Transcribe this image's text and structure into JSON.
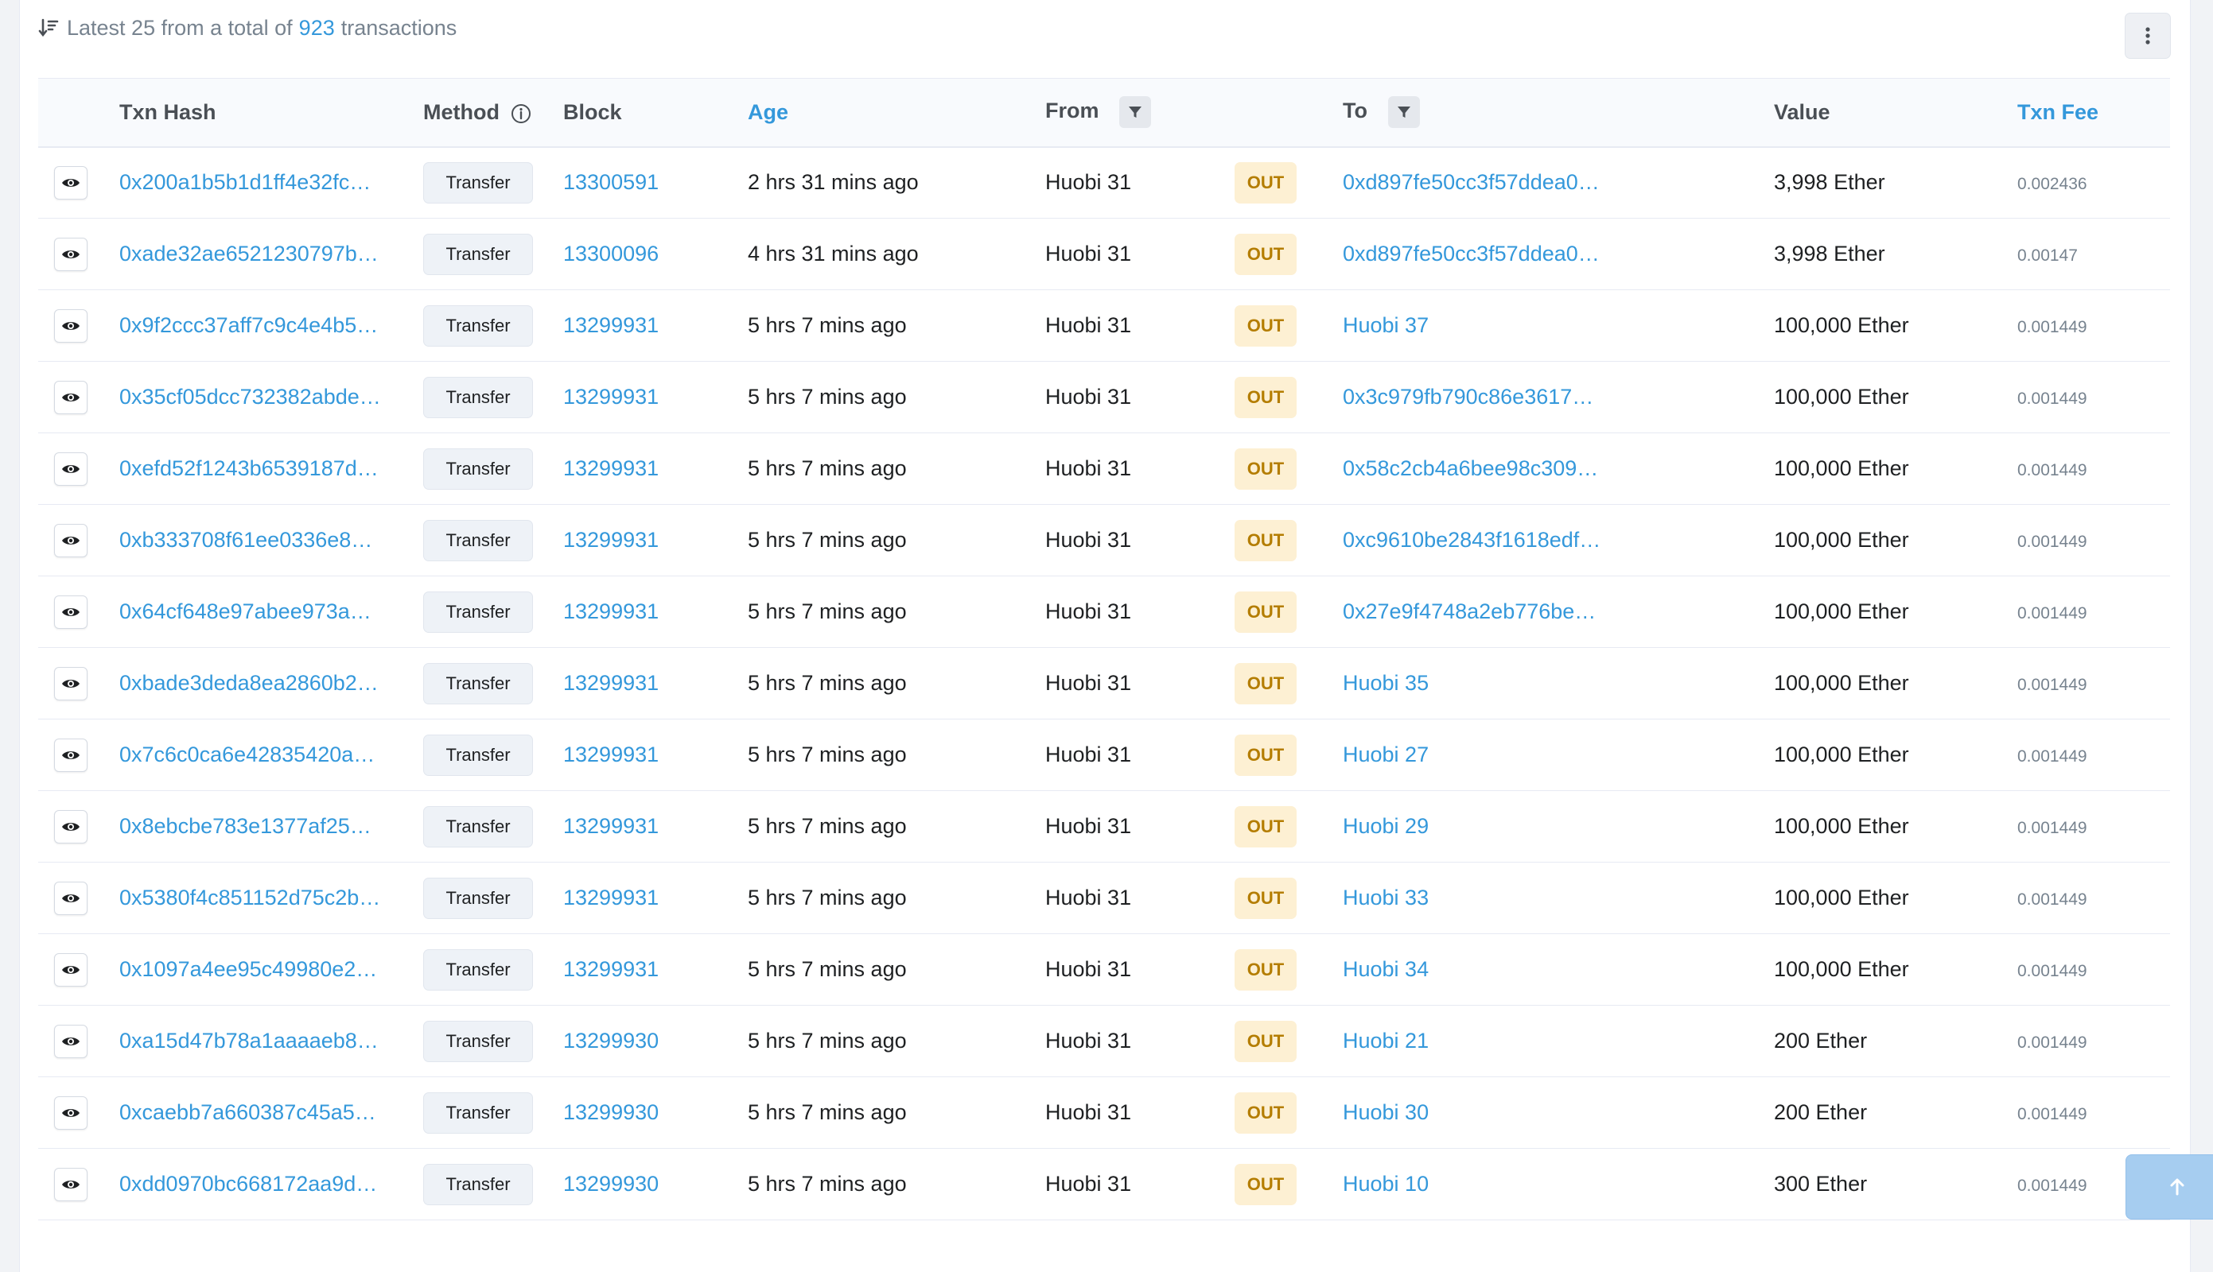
{
  "summary": {
    "prefix": "Latest 25 from a total of",
    "count": "923",
    "suffix": "transactions"
  },
  "table": {
    "headers": {
      "txn_hash": "Txn Hash",
      "method": "Method",
      "block": "Block",
      "age": "Age",
      "from": "From",
      "to": "To",
      "value": "Value",
      "txn_fee": "Txn Fee"
    },
    "rows": [
      {
        "hash": "0x200a1b5b1d1ff4e32fc…",
        "method": "Transfer",
        "block": "13300591",
        "age": "2 hrs 31 mins ago",
        "from": "Huobi 31",
        "dir": "OUT",
        "to": "0xd897fe50cc3f57ddea0…",
        "value": "3,998 Ether",
        "fee": "0.002436"
      },
      {
        "hash": "0xade32ae6521230797b…",
        "method": "Transfer",
        "block": "13300096",
        "age": "4 hrs 31 mins ago",
        "from": "Huobi 31",
        "dir": "OUT",
        "to": "0xd897fe50cc3f57ddea0…",
        "value": "3,998 Ether",
        "fee": "0.00147"
      },
      {
        "hash": "0x9f2ccc37aff7c9c4e4b5…",
        "method": "Transfer",
        "block": "13299931",
        "age": "5 hrs 7 mins ago",
        "from": "Huobi 31",
        "dir": "OUT",
        "to": "Huobi 37",
        "value": "100,000 Ether",
        "fee": "0.001449"
      },
      {
        "hash": "0x35cf05dcc732382abde…",
        "method": "Transfer",
        "block": "13299931",
        "age": "5 hrs 7 mins ago",
        "from": "Huobi 31",
        "dir": "OUT",
        "to": "0x3c979fb790c86e3617…",
        "value": "100,000 Ether",
        "fee": "0.001449"
      },
      {
        "hash": "0xefd52f1243b6539187d…",
        "method": "Transfer",
        "block": "13299931",
        "age": "5 hrs 7 mins ago",
        "from": "Huobi 31",
        "dir": "OUT",
        "to": "0x58c2cb4a6bee98c309…",
        "value": "100,000 Ether",
        "fee": "0.001449"
      },
      {
        "hash": "0xb333708f61ee0336e8…",
        "method": "Transfer",
        "block": "13299931",
        "age": "5 hrs 7 mins ago",
        "from": "Huobi 31",
        "dir": "OUT",
        "to": "0xc9610be2843f1618edf…",
        "value": "100,000 Ether",
        "fee": "0.001449"
      },
      {
        "hash": "0x64cf648e97abee973a…",
        "method": "Transfer",
        "block": "13299931",
        "age": "5 hrs 7 mins ago",
        "from": "Huobi 31",
        "dir": "OUT",
        "to": "0x27e9f4748a2eb776be…",
        "value": "100,000 Ether",
        "fee": "0.001449"
      },
      {
        "hash": "0xbade3deda8ea2860b2…",
        "method": "Transfer",
        "block": "13299931",
        "age": "5 hrs 7 mins ago",
        "from": "Huobi 31",
        "dir": "OUT",
        "to": "Huobi 35",
        "value": "100,000 Ether",
        "fee": "0.001449"
      },
      {
        "hash": "0x7c6c0ca6e42835420a…",
        "method": "Transfer",
        "block": "13299931",
        "age": "5 hrs 7 mins ago",
        "from": "Huobi 31",
        "dir": "OUT",
        "to": "Huobi 27",
        "value": "100,000 Ether",
        "fee": "0.001449"
      },
      {
        "hash": "0x8ebcbe783e1377af25…",
        "method": "Transfer",
        "block": "13299931",
        "age": "5 hrs 7 mins ago",
        "from": "Huobi 31",
        "dir": "OUT",
        "to": "Huobi 29",
        "value": "100,000 Ether",
        "fee": "0.001449"
      },
      {
        "hash": "0x5380f4c851152d75c2b…",
        "method": "Transfer",
        "block": "13299931",
        "age": "5 hrs 7 mins ago",
        "from": "Huobi 31",
        "dir": "OUT",
        "to": "Huobi 33",
        "value": "100,000 Ether",
        "fee": "0.001449"
      },
      {
        "hash": "0x1097a4ee95c49980e2…",
        "method": "Transfer",
        "block": "13299931",
        "age": "5 hrs 7 mins ago",
        "from": "Huobi 31",
        "dir": "OUT",
        "to": "Huobi 34",
        "value": "100,000 Ether",
        "fee": "0.001449"
      },
      {
        "hash": "0xa15d47b78a1aaaaeb8…",
        "method": "Transfer",
        "block": "13299930",
        "age": "5 hrs 7 mins ago",
        "from": "Huobi 31",
        "dir": "OUT",
        "to": "Huobi 21",
        "value": "200 Ether",
        "fee": "0.001449"
      },
      {
        "hash": "0xcaebb7a660387c45a5…",
        "method": "Transfer",
        "block": "13299930",
        "age": "5 hrs 7 mins ago",
        "from": "Huobi 31",
        "dir": "OUT",
        "to": "Huobi 30",
        "value": "200 Ether",
        "fee": "0.001449"
      },
      {
        "hash": "0xdd0970bc668172aa9d…",
        "method": "Transfer",
        "block": "13299930",
        "age": "5 hrs 7 mins ago",
        "from": "Huobi 31",
        "dir": "OUT",
        "to": "Huobi 10",
        "value": "300 Ether",
        "fee": "0.001449"
      }
    ]
  },
  "icons": {
    "sort": "sort-descending-icon",
    "more": "more-vertical-icon",
    "info": "info-circle-icon",
    "filter": "filter-icon",
    "eye": "eye-icon",
    "scroll_top": "arrow-up-icon"
  },
  "colors": {
    "link": "#3498db",
    "out_badge_bg": "#fdf0d3",
    "out_badge_text": "#b47d00",
    "scroll_top_bg": "#a6cdf0"
  }
}
